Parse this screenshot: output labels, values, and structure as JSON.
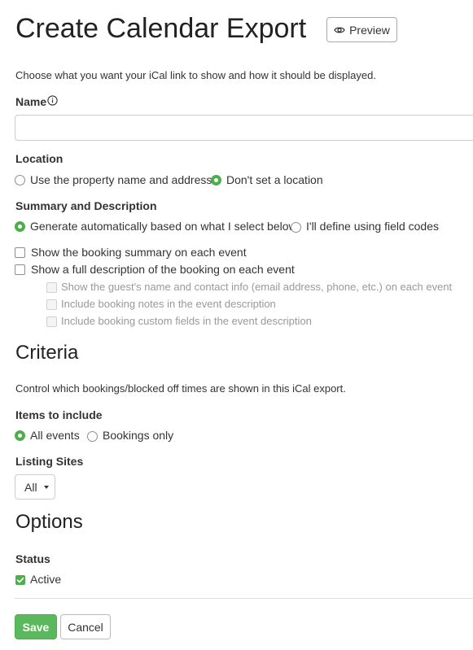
{
  "page": {
    "title": "Create Calendar Export",
    "preview_label": "Preview",
    "preview_icon": "eye-icon"
  },
  "intro": "Choose what you want your iCal link to show and how it should be displayed.",
  "name_field": {
    "label": "Name",
    "info_icon": "info-icon",
    "value": "",
    "placeholder": ""
  },
  "location": {
    "label": "Location",
    "options": [
      "Use the property name and address",
      "Don't set a location"
    ],
    "selected": 1
  },
  "summary": {
    "label": "Summary and Description",
    "options": [
      "Generate automatically based on what I select below",
      "I'll define using field codes"
    ],
    "selected": 0,
    "checks": [
      {
        "label": "Show the booking summary on each event",
        "checked": false
      },
      {
        "label": "Show a full description of the booking on each event",
        "checked": false
      }
    ],
    "sub_checks": [
      {
        "label": "Show the guest's name and contact info (email address, phone, etc.) on each event",
        "disabled": true
      },
      {
        "label": "Include booking notes in the event description",
        "disabled": true
      },
      {
        "label": "Include booking custom fields in the event description",
        "disabled": true
      }
    ]
  },
  "criteria": {
    "heading": "Criteria",
    "description": "Control which bookings/blocked off times are shown in this iCal export.",
    "items_label": "Items to include",
    "items_options": [
      "All events",
      "Bookings only"
    ],
    "items_selected": 0,
    "sites_label": "Listing Sites",
    "sites_value": "All"
  },
  "options": {
    "heading": "Options",
    "status_label": "Status",
    "active_label": "Active",
    "active_checked": true
  },
  "actions": {
    "save": "Save",
    "cancel": "Cancel"
  },
  "colors": {
    "accent_green": "#5cb85c",
    "radio_green": "#4cae4c"
  }
}
